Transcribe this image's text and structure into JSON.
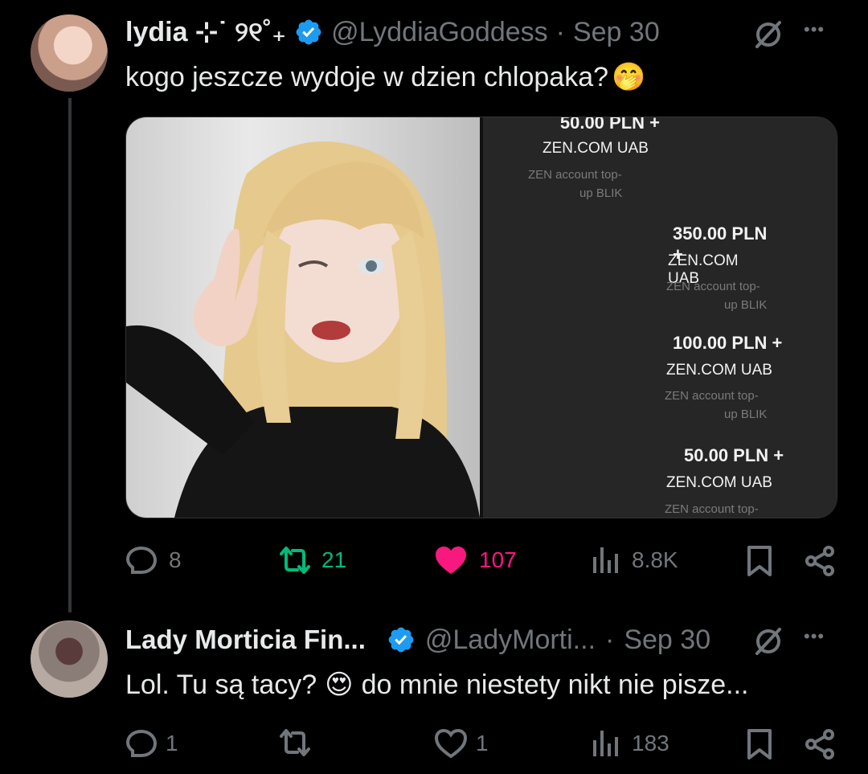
{
  "tweet": {
    "display_name": "lydia ⊹˙ ୨୧˚₊",
    "handle": "@LyddiaGoddess",
    "dot": "·",
    "date": "Sep 30",
    "text": "kogo jeszcze wydoje w dzien chlopaka?",
    "emoji": "🤭",
    "media": {
      "transactions": [
        {
          "amount": "50.00 PLN +",
          "merchant": "ZEN.COM UAB",
          "desc1": "ZEN account top-",
          "desc2": "up BLIK"
        },
        {
          "amount": "350.00 PLN +",
          "merchant": "ZEN.COM UAB",
          "desc1": "ZEN account top-",
          "desc2": "up BLIK"
        },
        {
          "amount": "100.00 PLN +",
          "merchant": "ZEN.COM UAB",
          "desc1": "ZEN account top-",
          "desc2": "up BLIK"
        },
        {
          "amount": "50.00 PLN +",
          "merchant": "ZEN.COM UAB",
          "desc1": "ZEN account top-",
          "desc2": ""
        }
      ]
    },
    "stats": {
      "replies": "8",
      "reposts": "21",
      "likes": "107",
      "views": "8.8K"
    },
    "colors": {
      "repost_active": "#00ba7c",
      "like_active": "#f91880",
      "verified": "#1d9bf0"
    }
  },
  "reply": {
    "display_name": "Lady Morticia Fin...",
    "handle": "@LadyMorti...",
    "dot": "·",
    "date": "Sep 30",
    "text_before": "Lol. Tu są tacy?",
    "emoji": "😍",
    "text_after": "do mnie niestety nikt nie pisze...",
    "stats": {
      "replies": "1",
      "likes": "1",
      "views": "183"
    }
  },
  "icons": {
    "more": "more-icon",
    "grok": "grok-icon",
    "reply": "reply-icon",
    "repost": "repost-icon",
    "like": "like-icon",
    "views": "views-icon",
    "bookmark": "bookmark-icon",
    "share": "share-icon",
    "more_glyph": "•••"
  }
}
